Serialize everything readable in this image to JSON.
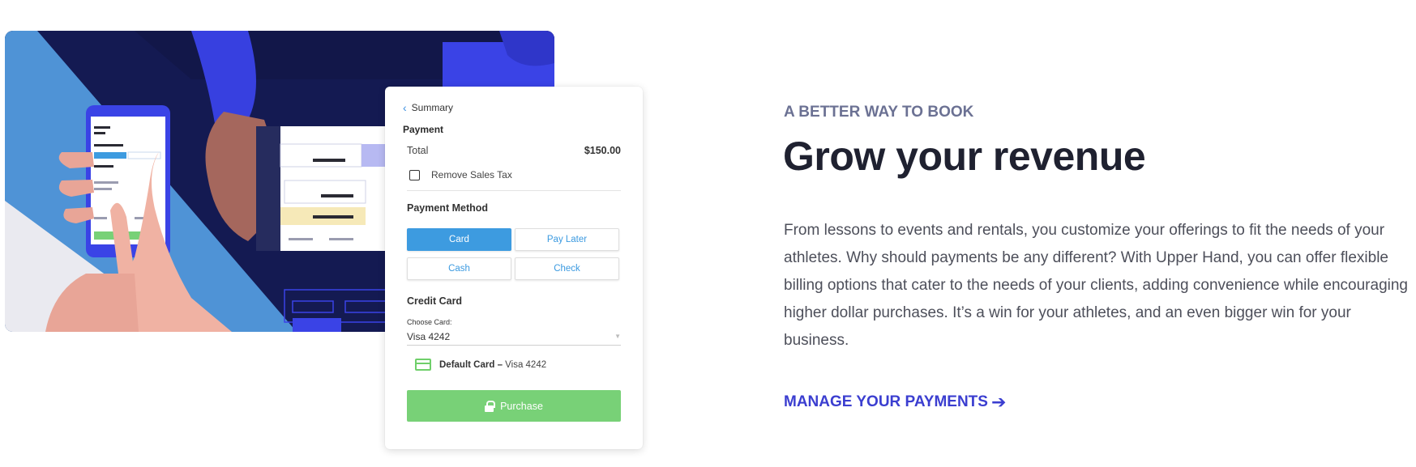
{
  "payment_card": {
    "back_label": "Summary",
    "payment_heading": "Payment",
    "total_label": "Total",
    "total_value": "$150.00",
    "remove_tax_label": "Remove Sales Tax",
    "method_heading": "Payment Method",
    "methods": [
      "Card",
      "Pay Later",
      "Cash",
      "Check"
    ],
    "selected_method": "Card",
    "credit_heading": "Credit Card",
    "choose_label": "Choose Card:",
    "choose_value": "Visa 4242",
    "default_label": "Default Card –",
    "default_value": "Visa 4242",
    "purchase_label": "Purchase"
  },
  "content": {
    "eyebrow": "A BETTER WAY TO BOOK",
    "headline": "Grow your revenue",
    "body": "From lessons to events and rentals, you customize your offerings to fit the needs of your athletes. Why should payments be any different? With Upper Hand, you can offer flexible billing options that cater to the needs of your clients, adding convenience while encouraging higher dollar purchases. It’s a win for your athletes, and an even bigger win for your business.",
    "cta_label": "MANAGE YOUR PAYMENTS"
  },
  "colors": {
    "accent_blue": "#3d9be0",
    "purchase_green": "#78d177",
    "cta_indigo": "#3b3ed0",
    "illustration_navy": "#141a52"
  },
  "icons": {
    "back": "chevron-left-icon",
    "card": "credit-card-icon",
    "lock": "lock-icon",
    "cta": "arrow-right-icon"
  }
}
